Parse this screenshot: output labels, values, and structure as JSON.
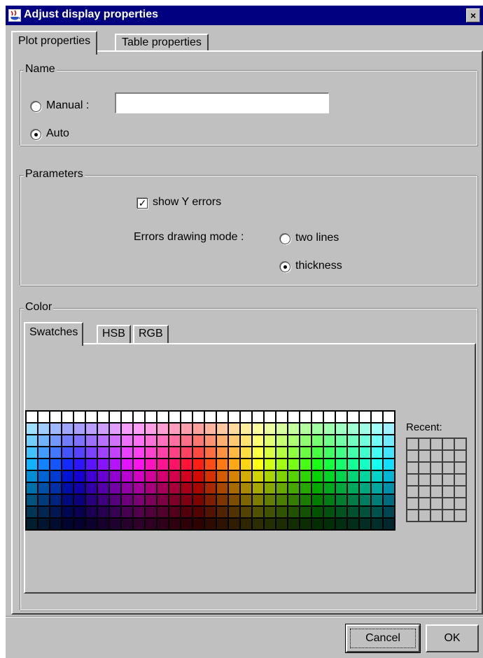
{
  "window": {
    "title": "Adjust display properties",
    "close_label": "×"
  },
  "tabs": [
    {
      "label": "Plot properties",
      "active": true
    },
    {
      "label": "Table properties",
      "active": false
    }
  ],
  "name_group": {
    "legend": "Name",
    "manual_label": "Manual :",
    "manual_value": "",
    "manual_selected": false,
    "auto_label": "Auto",
    "auto_selected": true
  },
  "parameters_group": {
    "legend": "Parameters",
    "show_y_errors_label": "show Y errors",
    "show_y_errors_checked": true,
    "errors_mode_label": "Errors drawing mode :",
    "two_lines_label": "two lines",
    "two_lines_selected": false,
    "thickness_label": "thickness",
    "thickness_selected": true
  },
  "color_group": {
    "legend": "Color",
    "tabs": [
      {
        "label": "Swatches",
        "active": true
      },
      {
        "label": "HSB",
        "active": false
      },
      {
        "label": "RGB",
        "active": false
      }
    ],
    "recent_label": "Recent:"
  },
  "buttons": {
    "cancel": "Cancel",
    "ok": "OK"
  },
  "colors": {
    "window_bg": "#c0c0c0",
    "titlebar_bg": "#000080",
    "titlebar_text": "#ffffff"
  }
}
